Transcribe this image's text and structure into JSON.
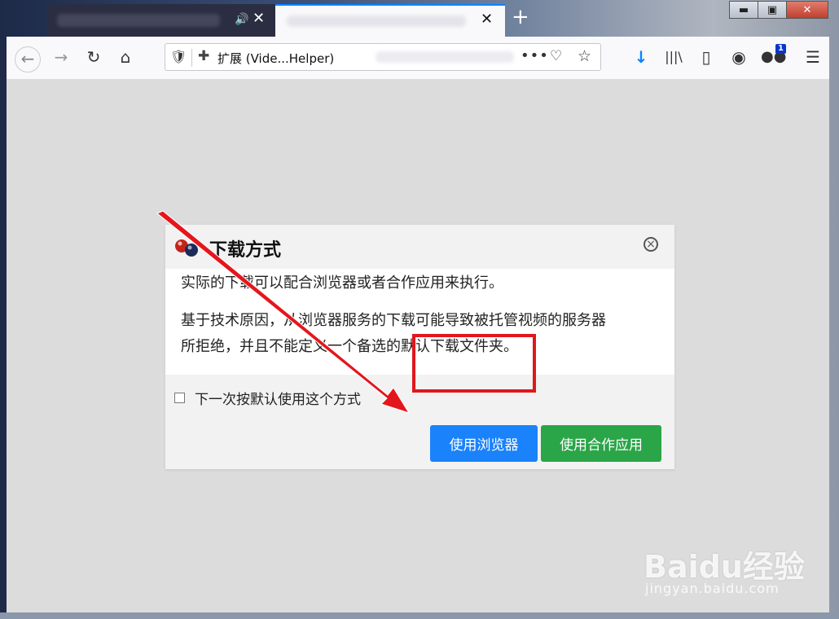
{
  "tabs": [
    {
      "title": "",
      "audio_icon": "speaker-icon",
      "close": "✕"
    },
    {
      "title": "",
      "close": "✕",
      "active": true
    }
  ],
  "new_tab_label": "+",
  "window_controls": {
    "minimize": "▬",
    "maximize": "▣",
    "close": "✕"
  },
  "toolbar": {
    "back": "←",
    "forward": "→",
    "reload": "↻",
    "home": "⌂",
    "url_label": "扩展 (Vide...Helper)",
    "more": "•••",
    "download": "↓",
    "library": "|||\\",
    "sidebar": "▯",
    "account": "◉",
    "extension_badge": "1",
    "menu": "☰"
  },
  "dialog": {
    "title": "下载方式",
    "close": "×",
    "paragraph1": "实际的下载可以配合浏览器或者合作应用来执行。",
    "paragraph2_line1": "基于技术原因，从浏览器服务的下载可能导致被托管视频的服务器",
    "paragraph2_line2": "所拒绝，并且不能定义一个备选的默认下载文件夹。",
    "checkbox_label": "下一次按默认使用这个方式",
    "checkbox_checked": false,
    "button_browser": "使用浏览器",
    "button_app": "使用合作应用"
  },
  "watermark": {
    "brand": "Baidu经验",
    "domain": "jingyan.baidu.com"
  },
  "colors": {
    "browser_button": "#1a82fb",
    "app_button": "#2aa548",
    "highlight": "#e0171d",
    "tab_accent": "#0a84ff"
  }
}
